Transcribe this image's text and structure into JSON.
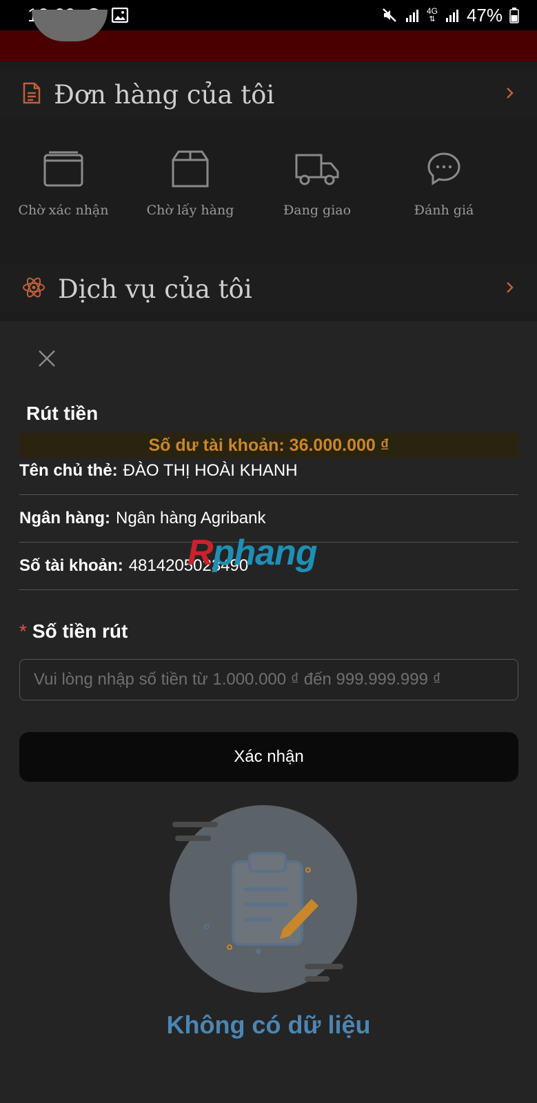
{
  "status_bar": {
    "time": "13:29",
    "battery": "47%",
    "network": "4G"
  },
  "background_page": {
    "orders_section": {
      "title": "Đơn hàng của tôi",
      "items": [
        {
          "label": "Chờ xác nhận",
          "icon": "wallet-icon"
        },
        {
          "label": "Chờ lấy hàng",
          "icon": "box-icon"
        },
        {
          "label": "Đang giao",
          "icon": "truck-icon"
        },
        {
          "label": "Đánh giá",
          "icon": "chat-icon"
        }
      ]
    },
    "services_section": {
      "title": "Dịch vụ của tôi"
    }
  },
  "withdraw_sheet": {
    "title": "Rút tiền",
    "balance": "Số dư tài khoản: 36.000.000 ₫",
    "card_holder_label": "Tên chủ thẻ:",
    "card_holder_value": "ĐÀO THỊ HOÀI KHANH",
    "bank_label": "Ngân hàng:",
    "bank_value": "Ngân hàng Agribank",
    "account_label": "Số tài khoản:",
    "account_value": "4814205023490",
    "amount_label": "Số tiền rút",
    "required_mark": "*",
    "amount_placeholder": "Vui lòng nhập số tiền từ 1.000.000 ₫ đến 999.999.999 ₫",
    "amount_value": "",
    "confirm_label": "Xác nhận",
    "empty_text": "Không có dữ liệu"
  },
  "watermark": {
    "part_a": "R",
    "part_b": "phang"
  },
  "colors": {
    "accent_orange": "#c8872a",
    "icon_orange": "#c0603a",
    "empty_blue": "#4b86b4",
    "sheet_bg": "#242424"
  }
}
